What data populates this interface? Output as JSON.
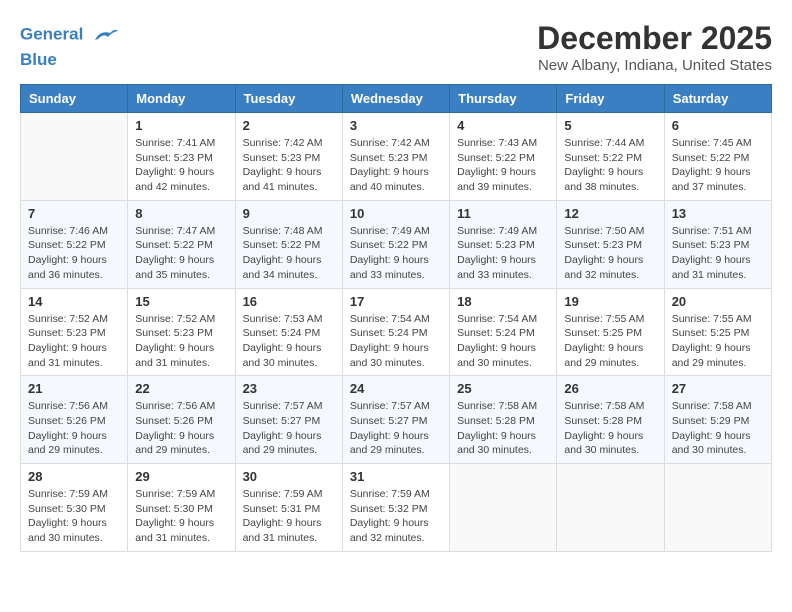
{
  "header": {
    "logo_line1": "General",
    "logo_line2": "Blue",
    "month_title": "December 2025",
    "location": "New Albany, Indiana, United States"
  },
  "days_of_week": [
    "Sunday",
    "Monday",
    "Tuesday",
    "Wednesday",
    "Thursday",
    "Friday",
    "Saturday"
  ],
  "weeks": [
    [
      {
        "day": "",
        "info": ""
      },
      {
        "day": "1",
        "info": "Sunrise: 7:41 AM\nSunset: 5:23 PM\nDaylight: 9 hours\nand 42 minutes."
      },
      {
        "day": "2",
        "info": "Sunrise: 7:42 AM\nSunset: 5:23 PM\nDaylight: 9 hours\nand 41 minutes."
      },
      {
        "day": "3",
        "info": "Sunrise: 7:42 AM\nSunset: 5:23 PM\nDaylight: 9 hours\nand 40 minutes."
      },
      {
        "day": "4",
        "info": "Sunrise: 7:43 AM\nSunset: 5:22 PM\nDaylight: 9 hours\nand 39 minutes."
      },
      {
        "day": "5",
        "info": "Sunrise: 7:44 AM\nSunset: 5:22 PM\nDaylight: 9 hours\nand 38 minutes."
      },
      {
        "day": "6",
        "info": "Sunrise: 7:45 AM\nSunset: 5:22 PM\nDaylight: 9 hours\nand 37 minutes."
      }
    ],
    [
      {
        "day": "7",
        "info": "Sunrise: 7:46 AM\nSunset: 5:22 PM\nDaylight: 9 hours\nand 36 minutes."
      },
      {
        "day": "8",
        "info": "Sunrise: 7:47 AM\nSunset: 5:22 PM\nDaylight: 9 hours\nand 35 minutes."
      },
      {
        "day": "9",
        "info": "Sunrise: 7:48 AM\nSunset: 5:22 PM\nDaylight: 9 hours\nand 34 minutes."
      },
      {
        "day": "10",
        "info": "Sunrise: 7:49 AM\nSunset: 5:22 PM\nDaylight: 9 hours\nand 33 minutes."
      },
      {
        "day": "11",
        "info": "Sunrise: 7:49 AM\nSunset: 5:23 PM\nDaylight: 9 hours\nand 33 minutes."
      },
      {
        "day": "12",
        "info": "Sunrise: 7:50 AM\nSunset: 5:23 PM\nDaylight: 9 hours\nand 32 minutes."
      },
      {
        "day": "13",
        "info": "Sunrise: 7:51 AM\nSunset: 5:23 PM\nDaylight: 9 hours\nand 31 minutes."
      }
    ],
    [
      {
        "day": "14",
        "info": "Sunrise: 7:52 AM\nSunset: 5:23 PM\nDaylight: 9 hours\nand 31 minutes."
      },
      {
        "day": "15",
        "info": "Sunrise: 7:52 AM\nSunset: 5:23 PM\nDaylight: 9 hours\nand 31 minutes."
      },
      {
        "day": "16",
        "info": "Sunrise: 7:53 AM\nSunset: 5:24 PM\nDaylight: 9 hours\nand 30 minutes."
      },
      {
        "day": "17",
        "info": "Sunrise: 7:54 AM\nSunset: 5:24 PM\nDaylight: 9 hours\nand 30 minutes."
      },
      {
        "day": "18",
        "info": "Sunrise: 7:54 AM\nSunset: 5:24 PM\nDaylight: 9 hours\nand 30 minutes."
      },
      {
        "day": "19",
        "info": "Sunrise: 7:55 AM\nSunset: 5:25 PM\nDaylight: 9 hours\nand 29 minutes."
      },
      {
        "day": "20",
        "info": "Sunrise: 7:55 AM\nSunset: 5:25 PM\nDaylight: 9 hours\nand 29 minutes."
      }
    ],
    [
      {
        "day": "21",
        "info": "Sunrise: 7:56 AM\nSunset: 5:26 PM\nDaylight: 9 hours\nand 29 minutes."
      },
      {
        "day": "22",
        "info": "Sunrise: 7:56 AM\nSunset: 5:26 PM\nDaylight: 9 hours\nand 29 minutes."
      },
      {
        "day": "23",
        "info": "Sunrise: 7:57 AM\nSunset: 5:27 PM\nDaylight: 9 hours\nand 29 minutes."
      },
      {
        "day": "24",
        "info": "Sunrise: 7:57 AM\nSunset: 5:27 PM\nDaylight: 9 hours\nand 29 minutes."
      },
      {
        "day": "25",
        "info": "Sunrise: 7:58 AM\nSunset: 5:28 PM\nDaylight: 9 hours\nand 30 minutes."
      },
      {
        "day": "26",
        "info": "Sunrise: 7:58 AM\nSunset: 5:28 PM\nDaylight: 9 hours\nand 30 minutes."
      },
      {
        "day": "27",
        "info": "Sunrise: 7:58 AM\nSunset: 5:29 PM\nDaylight: 9 hours\nand 30 minutes."
      }
    ],
    [
      {
        "day": "28",
        "info": "Sunrise: 7:59 AM\nSunset: 5:30 PM\nDaylight: 9 hours\nand 30 minutes."
      },
      {
        "day": "29",
        "info": "Sunrise: 7:59 AM\nSunset: 5:30 PM\nDaylight: 9 hours\nand 31 minutes."
      },
      {
        "day": "30",
        "info": "Sunrise: 7:59 AM\nSunset: 5:31 PM\nDaylight: 9 hours\nand 31 minutes."
      },
      {
        "day": "31",
        "info": "Sunrise: 7:59 AM\nSunset: 5:32 PM\nDaylight: 9 hours\nand 32 minutes."
      },
      {
        "day": "",
        "info": ""
      },
      {
        "day": "",
        "info": ""
      },
      {
        "day": "",
        "info": ""
      }
    ]
  ]
}
